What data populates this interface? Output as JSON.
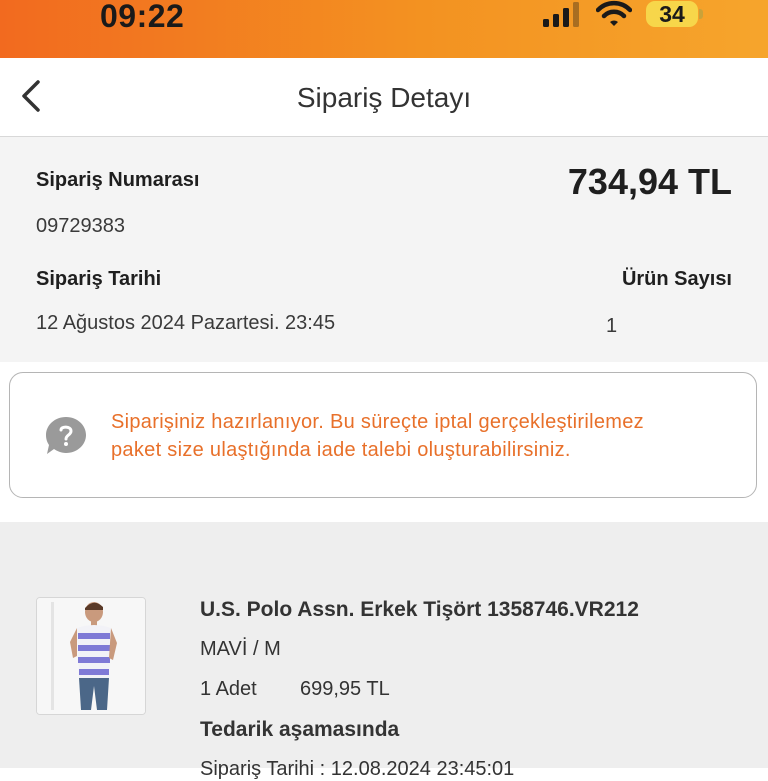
{
  "status_bar": {
    "time": "09:22",
    "battery": "34"
  },
  "header": {
    "title": "Sipariş Detayı",
    "back_icon": "chevron-left-icon"
  },
  "order": {
    "number_label": "Sipariş Numarası",
    "number": "09729383",
    "total": "734,94 TL",
    "date_label": "Sipariş Tarihi",
    "date": "12 Ağustos 2024 Pazartesi. 23:45",
    "item_count_label": "Ürün Sayısı",
    "item_count": "1"
  },
  "notice": {
    "icon": "question-bubble-icon",
    "line1": "Siparişiniz hazırlanıyor. Bu süreçte iptal gerçekleştirilemez",
    "line2": "paket size ulaştığında iade talebi oluşturabilirsiniz.",
    "color": "#e8702a"
  },
  "product": {
    "name": "U.S. Polo Assn. Erkek Tişört 1358746.VR212",
    "variant": "MAVİ / M",
    "quantity": "1 Adet",
    "price": "699,95 TL",
    "status": "Tedarik aşamasında",
    "date_line": "Sipariş Tarihi : 12.08.2024 23:45:01"
  },
  "colors": {
    "status_bar_start": "#f26a1f",
    "status_bar_end": "#f6a52c",
    "accent": "#e8702a"
  }
}
